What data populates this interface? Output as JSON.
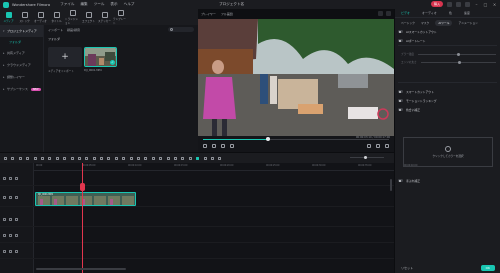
{
  "app": {
    "name": "Wondershare Filmora",
    "project_title": "プロジェクト名",
    "menu": [
      "ファイル",
      "編集",
      "ツール",
      "表示",
      "ヘルプ"
    ],
    "badge": "購入",
    "colors": {
      "accent": "#19c6b2",
      "playhead": "#e2364e",
      "badge": "#d8344f",
      "bg": "#141519"
    }
  },
  "toolbar": {
    "tools": [
      {
        "label": "メディア",
        "icon": "media-icon"
      },
      {
        "label": "ストック",
        "icon": "stock-icon"
      },
      {
        "label": "オーディオ",
        "icon": "audio-icon"
      },
      {
        "label": "タイトル",
        "icon": "title-icon"
      },
      {
        "label": "トランジション",
        "icon": "transition-icon"
      },
      {
        "label": "エフェクト",
        "icon": "effect-icon"
      },
      {
        "label": "ステッカー",
        "icon": "sticker-icon"
      },
      {
        "label": "テンプレート",
        "icon": "template-icon"
      }
    ]
  },
  "sidebar": {
    "items": [
      {
        "label": "プロジェクトメディア"
      },
      {
        "label": "フォルダ"
      },
      {
        "label": "共有メディア"
      },
      {
        "label": "クラウドメディア"
      },
      {
        "label": "調整レイヤー"
      },
      {
        "label": "サブシーケンス",
        "badge": "NEW"
      }
    ]
  },
  "media": {
    "top_items": [
      "インポート",
      "録画/録音"
    ],
    "folder_label": "フォルダ",
    "import_caption": "メディアをインポート",
    "clip_caption": "DJI_0001.MP4"
  },
  "preview": {
    "tabs": [
      "プレイヤー",
      "フル画質"
    ],
    "timecode": "00:00:03:10 / 00:00:17:06",
    "progress": 0.35
  },
  "props": {
    "tabs": [
      "ビデオ",
      "オーディオ",
      "色",
      "速度"
    ],
    "subtabs": [
      "ベーシック",
      "マスク",
      "AIツール",
      "アニメーション"
    ],
    "rows": [
      "AIスマートカットアウト",
      "AIポートレート"
    ],
    "sliders": [
      "ブラー強度",
      "エッジの太さ"
    ],
    "rows2": [
      "スマートカットアウト",
      "モーショントラッキング",
      "色合い補正"
    ],
    "drop_text": "クリックしてカラーを選択",
    "row3": "手ぶれ補正",
    "reset": "リセット",
    "ok": "OK"
  },
  "timeline": {
    "ticks": [
      "00:00",
      "00:00:05:00",
      "00:00:10:00",
      "00:00:15:00",
      "00:00:20:00",
      "00:00:25:00",
      "00:00:30:00",
      "00:00:35:00",
      "00:00:40:00"
    ],
    "clip_label": "DJI_0001.MP4"
  }
}
